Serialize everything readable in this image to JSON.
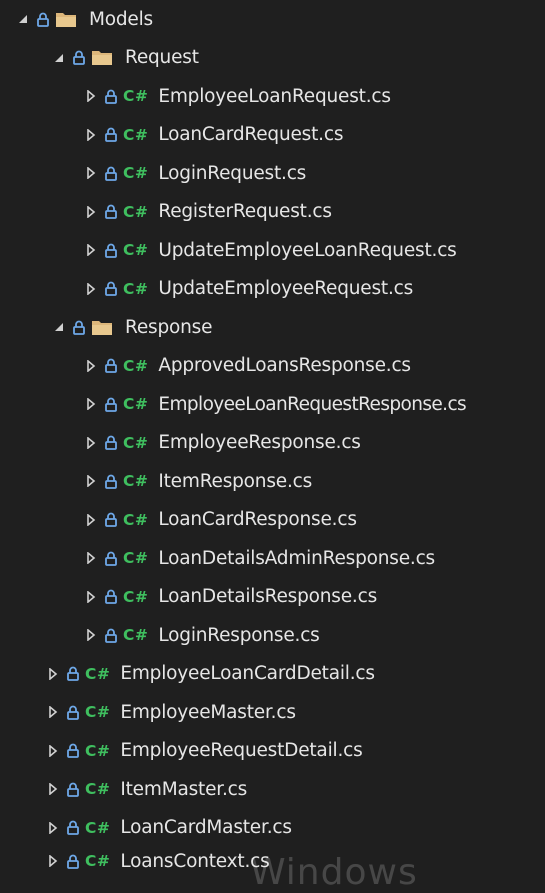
{
  "colors": {
    "background": "#1f1f1f",
    "text": "#e6e6e6",
    "lock": "#6ea8e8",
    "folder": "#dcb67a",
    "csharp": "#3fbf5f",
    "arrow": "#d0d0d0"
  },
  "tree": {
    "root": {
      "label": "Models",
      "icon": "folder-icon",
      "expanded": true
    },
    "request_folder": {
      "label": "Request",
      "icon": "folder-icon",
      "expanded": true
    },
    "request_files": [
      {
        "label": "EmployeeLoanRequest.cs",
        "icon": "csharp-file-icon"
      },
      {
        "label": "LoanCardRequest.cs",
        "icon": "csharp-file-icon"
      },
      {
        "label": "LoginRequest.cs",
        "icon": "csharp-file-icon"
      },
      {
        "label": "RegisterRequest.cs",
        "icon": "csharp-file-icon"
      },
      {
        "label": "UpdateEmployeeLoanRequest.cs",
        "icon": "csharp-file-icon"
      },
      {
        "label": "UpdateEmployeeRequest.cs",
        "icon": "csharp-file-icon"
      }
    ],
    "response_folder": {
      "label": "Response",
      "icon": "folder-icon",
      "expanded": true
    },
    "response_files": [
      {
        "label": "ApprovedLoansResponse.cs",
        "icon": "csharp-file-icon"
      },
      {
        "label": "EmployeeLoanRequestResponse.cs",
        "icon": "csharp-file-icon"
      },
      {
        "label": "EmployeeResponse.cs",
        "icon": "csharp-file-icon"
      },
      {
        "label": "ItemResponse.cs",
        "icon": "csharp-file-icon"
      },
      {
        "label": "LoanCardResponse.cs",
        "icon": "csharp-file-icon"
      },
      {
        "label": "LoanDetailsAdminResponse.cs",
        "icon": "csharp-file-icon"
      },
      {
        "label": "LoanDetailsResponse.cs",
        "icon": "csharp-file-icon"
      },
      {
        "label": "LoginResponse.cs",
        "icon": "csharp-file-icon"
      }
    ],
    "model_files": [
      {
        "label": "EmployeeLoanCardDetail.cs",
        "icon": "csharp-file-icon"
      },
      {
        "label": "EmployeeMaster.cs",
        "icon": "csharp-file-icon"
      },
      {
        "label": "EmployeeRequestDetail.cs",
        "icon": "csharp-file-icon"
      },
      {
        "label": "ItemMaster.cs",
        "icon": "csharp-file-icon"
      },
      {
        "label": "LoanCardMaster.cs",
        "icon": "csharp-file-icon"
      },
      {
        "label": "LoansContext.cs",
        "icon": "csharp-file-icon"
      }
    ],
    "csharp_badge": "C#"
  },
  "watermark": "Windows"
}
